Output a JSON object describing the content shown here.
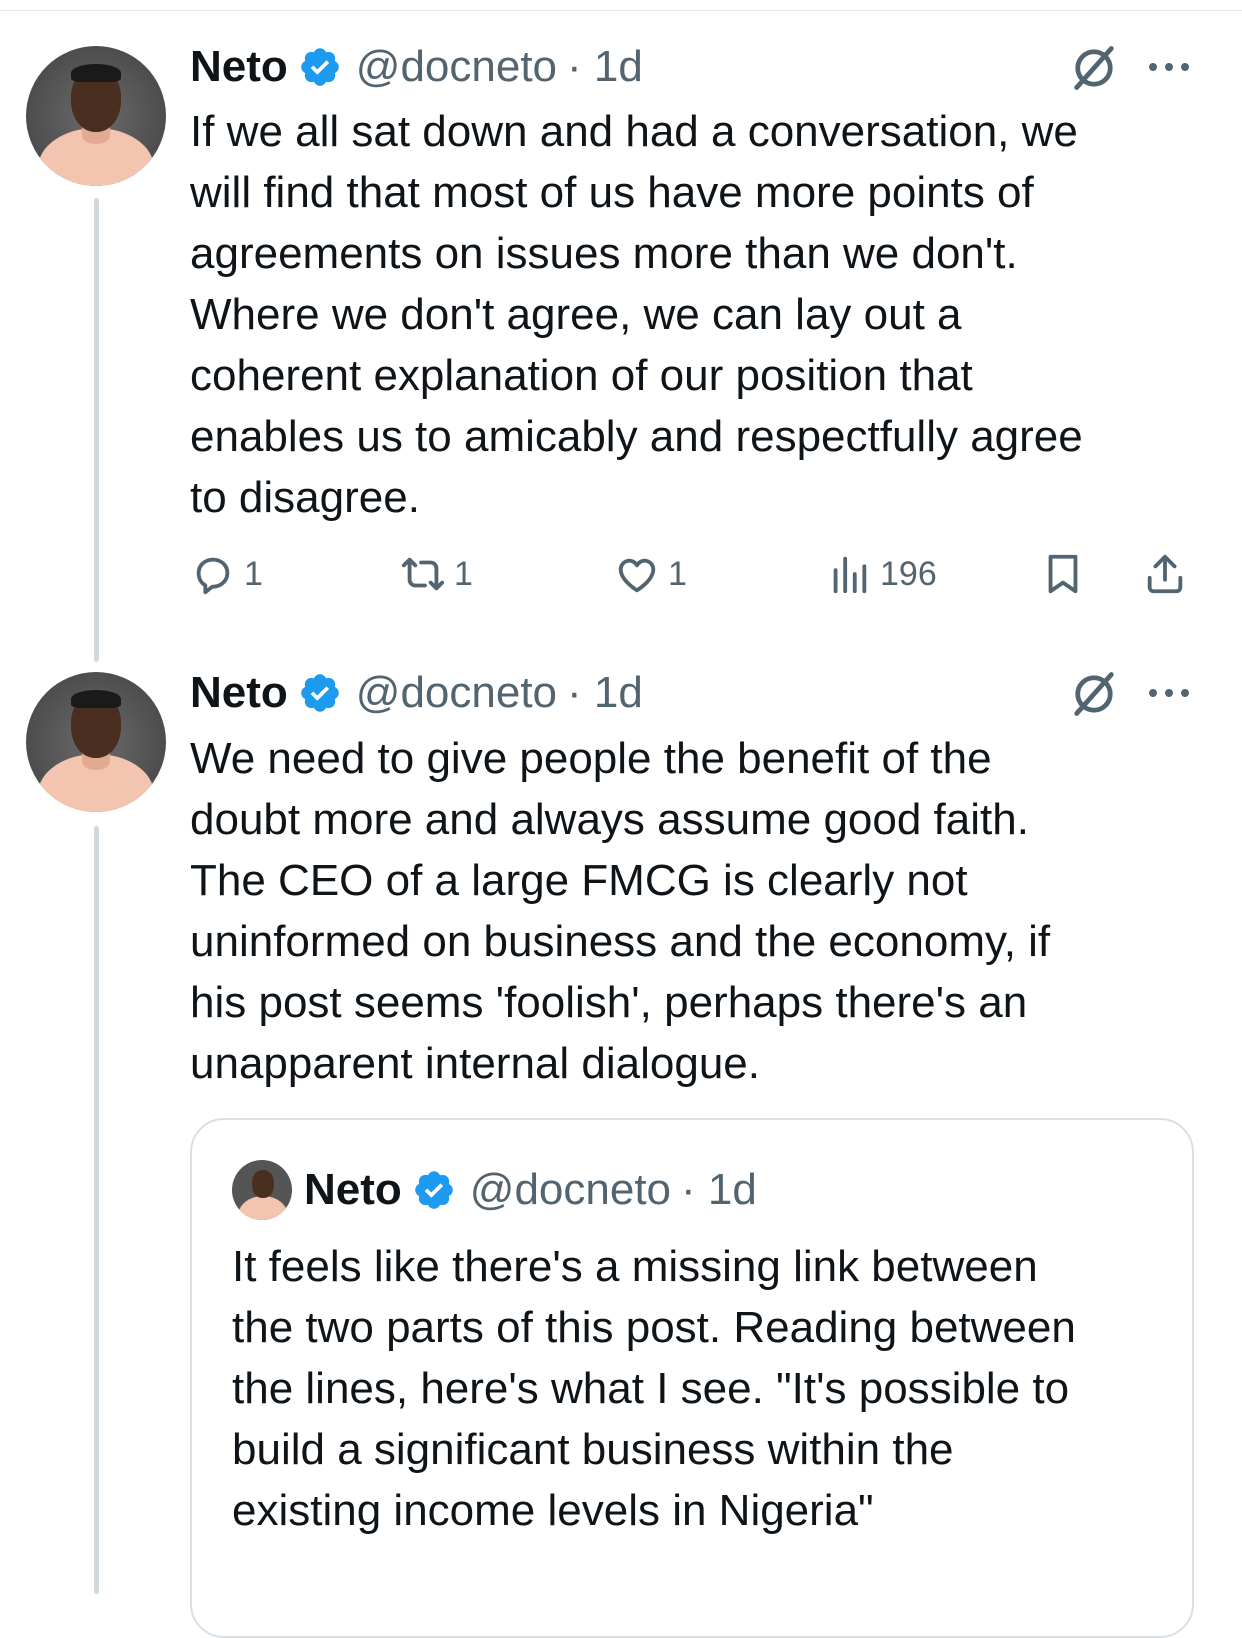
{
  "tweets": [
    {
      "author_name": "Neto",
      "handle": "@docneto",
      "time": "· 1d",
      "text": "If we all sat down and had a conversation, we\nwill find that most of us have more points of\nagreements on issues more than we don't.\nWhere we don't agree, we can lay out a\ncoherent explanation of our position that\nenables us to amicably and respectfully agree\nto disagree.",
      "replies": "1",
      "reposts": "1",
      "likes": "1",
      "views": "196"
    },
    {
      "author_name": "Neto",
      "handle": "@docneto",
      "time": "· 1d",
      "text": "We need to give people the benefit of the\ndoubt more and always assume good faith.\nThe CEO of a large FMCG is clearly not\nuninformed on business and the economy, if\nhis post seems 'foolish', perhaps there's an\nunapparent internal dialogue.",
      "quote": {
        "author_name": "Neto",
        "handle": "@docneto",
        "time": "· 1d",
        "text": "It feels like there's a missing link between\nthe two parts of this post. Reading between\nthe lines, here's what I see. \"It's possible to\nbuild a significant business within the\nexisting income levels in Nigeria\""
      }
    }
  ],
  "colors": {
    "verified_blue": "#1d9bf0",
    "secondary_text": "#536471",
    "thread_line": "#cfd9de"
  },
  "icons": [
    "verified-badge-icon",
    "grok-icon",
    "more-icon",
    "reply-icon",
    "repost-icon",
    "like-icon",
    "views-icon",
    "bookmark-icon",
    "share-icon"
  ]
}
